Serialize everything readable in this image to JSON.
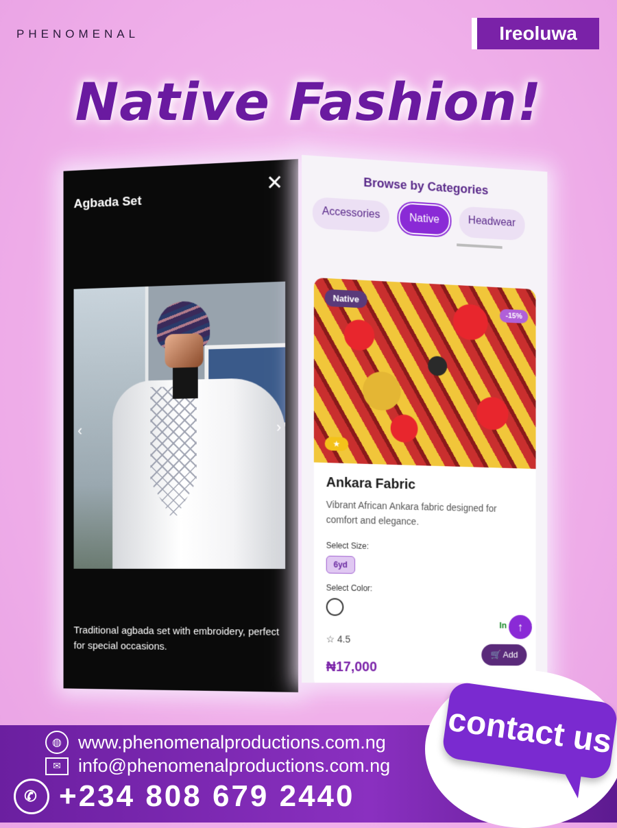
{
  "brand": "PHENOMENAL",
  "author": "Ireoluwa",
  "headline": "Native Fashion!",
  "left_panel": {
    "title": "Agbada Set",
    "close_icon": "close-icon",
    "description": "Traditional agbada set with embroidery, perfect for special occasions."
  },
  "right_panel": {
    "heading": "Browse by Categories",
    "categories": [
      "Accessories",
      "Native",
      "Headwear"
    ],
    "active_category": "Native",
    "product": {
      "category_badge": "Native",
      "discount_badge": "-15%",
      "featured_icon": "star-icon",
      "name": "Ankara Fabric",
      "description": "Vibrant African Ankara fabric designed for comfort and elegance.",
      "size_label": "Select Size:",
      "size_option": "6yd",
      "color_label": "Select Color:",
      "stock": "In Stock",
      "rating": "4.5",
      "price": "₦17,000",
      "add_label": "Add"
    }
  },
  "footer": {
    "website": "www.phenomenalproductions.com.ng",
    "email": "info@phenomenalproductions.com.ng",
    "phone": "+234 808 679 2440"
  },
  "cta": "contact us",
  "colors": {
    "accent": "#7a22a8",
    "background": "#f0b0ea",
    "footer": "#6b1fa0"
  }
}
